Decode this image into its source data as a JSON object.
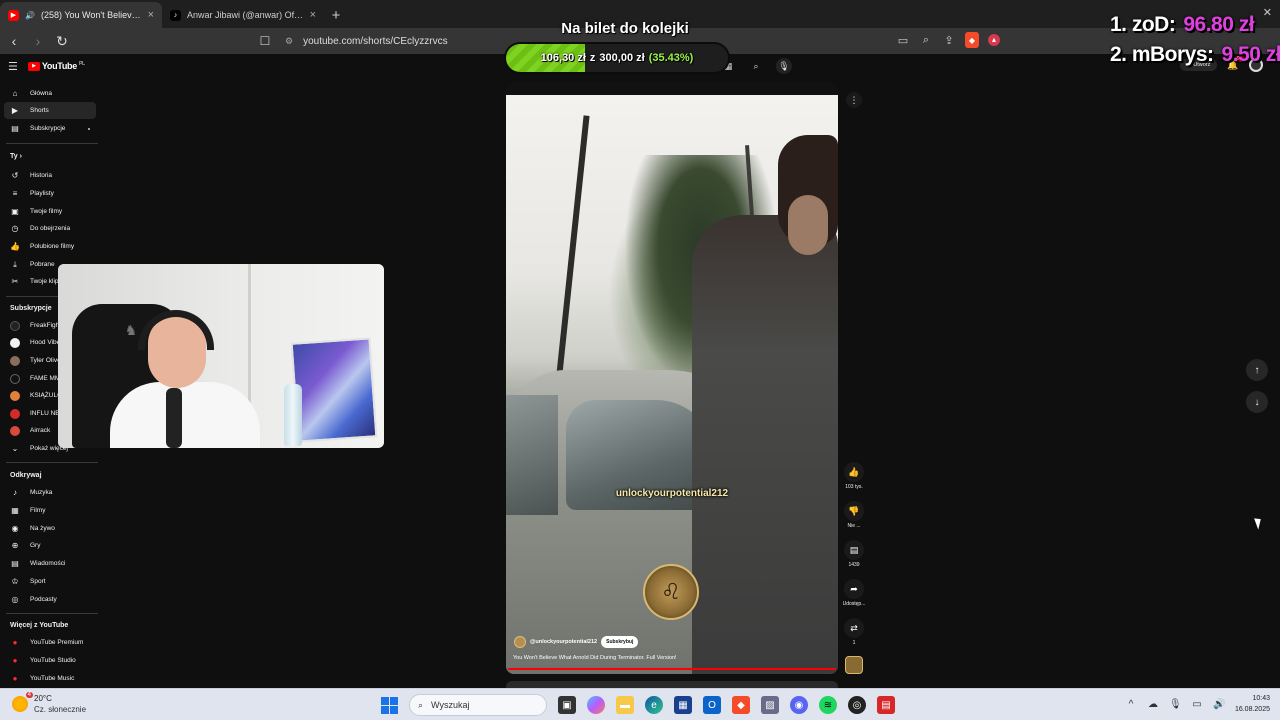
{
  "browser": {
    "tabs": [
      {
        "title": "(258) You Won't Believe What...",
        "active": true
      },
      {
        "title": "Anwar Jibawi (@anwar) Official | TikT...",
        "active": false
      }
    ],
    "url": "youtube.com/shorts/CEclyzzrvcs"
  },
  "youtube": {
    "logo": "YouTube",
    "logo_country": "PL",
    "sidebar": {
      "main": [
        {
          "label": "Główna",
          "icon": "home-icon"
        },
        {
          "label": "Shorts",
          "icon": "shorts-icon",
          "active": true
        },
        {
          "label": "Subskrypcje",
          "icon": "subscriptions-icon"
        }
      ],
      "you_header": "Ty",
      "you": [
        {
          "label": "Historia",
          "icon": "history-icon"
        },
        {
          "label": "Playlisty",
          "icon": "playlist-icon"
        },
        {
          "label": "Twoje filmy",
          "icon": "your-videos-icon"
        },
        {
          "label": "Do obejrzenia",
          "icon": "watch-later-icon"
        },
        {
          "label": "Polubione filmy",
          "icon": "like-icon"
        },
        {
          "label": "Pobrane",
          "icon": "download-icon"
        },
        {
          "label": "Twoje klipy",
          "icon": "clips-icon"
        }
      ],
      "subs_header": "Subskrypcje",
      "subs": [
        {
          "label": "FreakFight",
          "color": "#222222"
        },
        {
          "label": "Hood Vibes",
          "color": "#f1f1f1"
        },
        {
          "label": "Tyler Oliveira",
          "color": "#8a6d5a"
        },
        {
          "label": "FAME MMA",
          "color": "#111111"
        },
        {
          "label": "KSIĄŻULO",
          "color": "#e0803a"
        },
        {
          "label": "INFLU NEWS",
          "color": "#d52a2a"
        },
        {
          "label": "Airrack",
          "color": "#d84a3a"
        },
        {
          "label": "Pokaż więcej",
          "icon": "chevron-down-icon"
        }
      ],
      "explore_header": "Odkrywaj",
      "explore": [
        {
          "label": "Muzyka",
          "icon": "music-icon"
        },
        {
          "label": "Filmy",
          "icon": "movies-icon"
        },
        {
          "label": "Na żywo",
          "icon": "live-icon"
        },
        {
          "label": "Gry",
          "icon": "gaming-icon"
        },
        {
          "label": "Wiadomości",
          "icon": "news-icon"
        },
        {
          "label": "Sport",
          "icon": "trophy-icon"
        },
        {
          "label": "Podcasty",
          "icon": "podcast-icon"
        }
      ],
      "more_header": "Więcej z YouTube",
      "more": [
        {
          "label": "YouTube Premium"
        },
        {
          "label": "YouTube Studio"
        },
        {
          "label": "YouTube Music"
        }
      ]
    },
    "header": {
      "create_label": "Utwórz",
      "notifications_badge": "9+"
    },
    "short": {
      "watermark": "unlockyourpotential212",
      "channel": "@unlockyourpotential212",
      "subscribe_label": "Subskrybuj",
      "title": "You Won't Believe What Arnold Did During Terminator. Full Version!",
      "likes": "103 tys.",
      "dislike_label": "Nie ...",
      "comments": "1439",
      "share_label": "Udostęp...",
      "remix_count": "1"
    }
  },
  "stream_overlay": {
    "goal_title": "Na bilet do kolejki",
    "goal_current": "106,30 zł",
    "goal_sep": "z",
    "goal_target": "300,00 zł",
    "goal_percent_text": "(35.43%)",
    "goal_fraction": 0.3543,
    "top_donors": [
      {
        "rank_name": "1. zoD:",
        "amount": "96.80 zł"
      },
      {
        "rank_name": "2. mBorys:",
        "amount": "9.50 zł"
      }
    ]
  },
  "taskbar": {
    "temp": "20°C",
    "weather": "Cz. słonecznie",
    "weather_badge": "4",
    "search_placeholder": "Wyszukaj",
    "time": "10:43",
    "date": "16.08.2025"
  }
}
